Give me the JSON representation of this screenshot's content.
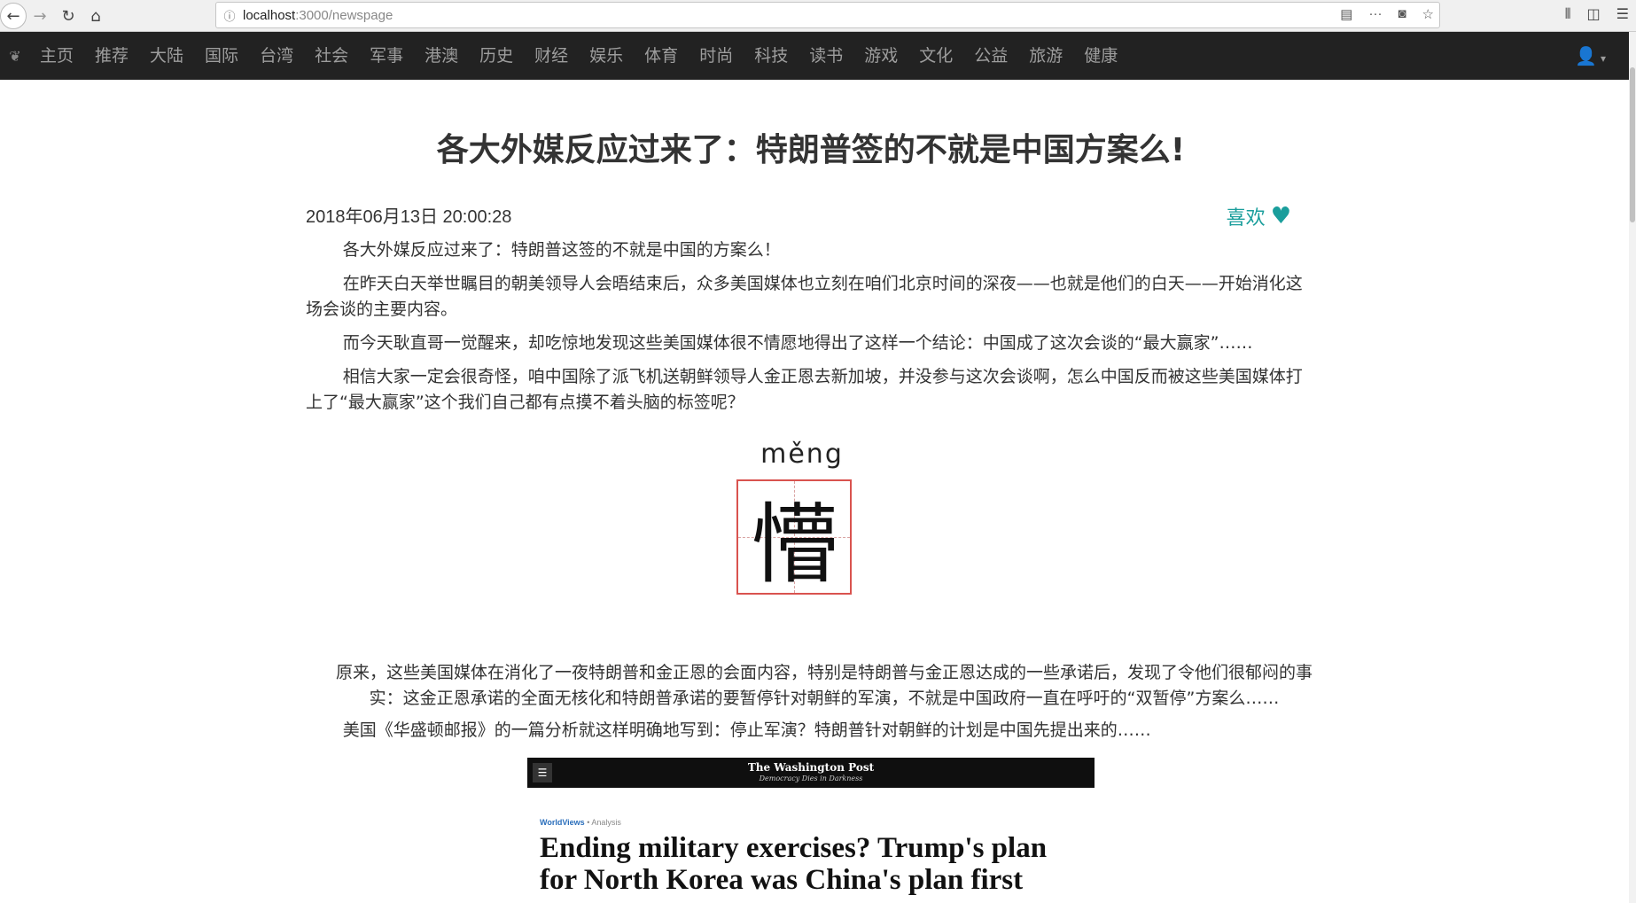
{
  "browser": {
    "url_host": "localhost",
    "url_path": ":3000/newspage"
  },
  "nav": {
    "items": [
      "主页",
      "推荐",
      "大陆",
      "国际",
      "台湾",
      "社会",
      "军事",
      "港澳",
      "历史",
      "财经",
      "娱乐",
      "体育",
      "时尚",
      "科技",
      "读书",
      "游戏",
      "文化",
      "公益",
      "旅游",
      "健康"
    ]
  },
  "article": {
    "title": "各大外媒反应过来了：特朗普签的不就是中国方案么!",
    "date": "2018年06月13日 20:00:28",
    "like_label": "喜欢",
    "paragraphs": [
      "各大外媒反应过来了：特朗普这签的不就是中国的方案么！",
      "在昨天白天举世瞩目的朝美领导人会晤结束后，众多美国媒体也立刻在咱们北京时间的深夜——也就是他们的白天——开始消化这场会谈的主要内容。",
      "而今天耿直哥一觉醒来，却吃惊地发现这些美国媒体很不情愿地得出了这样一个结论：中国成了这次会谈的“最大赢家”……",
      "相信大家一定会很奇怪，咱中国除了派飞机送朝鲜领导人金正恩去新加坡，并没参与这次会谈啊，怎么中国反而被这些美国媒体打上了“最大赢家”这个我们自己都有点摸不着头脑的标签呢？"
    ],
    "pinyin": "měng",
    "character": "懵",
    "paragraph_after_char": "原来，这些美国媒体在消化了一夜特朗普和金正恩的会面内容，特别是特朗普与金正恩达成的一些承诺后，发现了令他们很郁闷的事实：这金正恩承诺的全面无核化和特朗普承诺的要暂停针对朝鲜的军演，不就是中国政府一直在呼吁的“双暂停”方案么……",
    "paragraph_wapo": "美国《华盛顿邮报》的一篇分析就这样明确地写到：停止军演？特朗普针对朝鲜的计划是中国先提出来的……"
  },
  "wapo": {
    "logo": "The Washington Post",
    "tagline": "Democracy Dies in Darkness",
    "section": "WorldViews",
    "section_sep": "•",
    "kind": "Analysis",
    "headline": "Ending military exercises? Trump's plan for North Korea was China's plan first"
  }
}
